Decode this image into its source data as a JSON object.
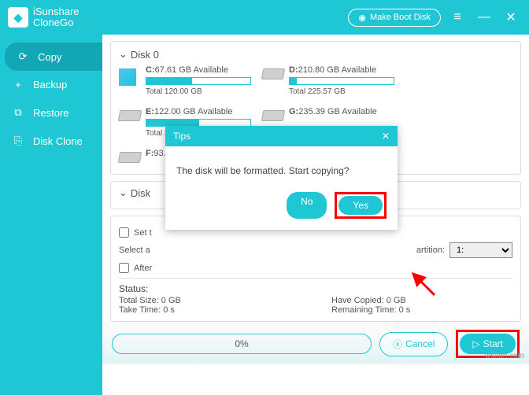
{
  "titlebar": {
    "brand1": "iSunshare",
    "brand2": "CloneGo",
    "bootDisk": "Make Boot Disk"
  },
  "sidebar": {
    "items": [
      {
        "label": "Copy",
        "icon": "⟳"
      },
      {
        "label": "Backup",
        "icon": "+"
      },
      {
        "label": "Restore",
        "icon": "⧉"
      },
      {
        "label": "Disk Clone",
        "icon": "⎘"
      }
    ]
  },
  "disk0": {
    "title": "Disk 0",
    "drives": [
      {
        "letter": "C:",
        "avail": "67.61 GB Available",
        "total": "Total 120.00 GB",
        "fill": 44,
        "icon": "win"
      },
      {
        "letter": "D:",
        "avail": "210.80 GB Available",
        "total": "Total 225.57 GB",
        "fill": 7,
        "icon": "hdd"
      },
      {
        "letter": "E:",
        "avail": "122.00 GB Available",
        "total": "Total 250.00 GB",
        "fill": 51,
        "icon": "hdd"
      },
      {
        "letter": "G:",
        "avail": "235.39 GB Available",
        "total": "",
        "fill": 0,
        "icon": "hdd"
      },
      {
        "letter": "F:",
        "avail": "93.12 GB Available",
        "total": "",
        "fill": 0,
        "icon": "hdd"
      }
    ]
  },
  "disk_other": {
    "title": "Disk"
  },
  "options": {
    "setLabel": "Set t",
    "selectLabel": "Select a",
    "afterLabel": "After",
    "partitionLabel": "artition:",
    "partitionValue": "1:"
  },
  "status": {
    "title": "Status:",
    "totalSize": "Total Size: 0 GB",
    "takeTime": "Take Time: 0 s",
    "haveCopied": "Have Copied: 0 GB",
    "remainTime": "Remaining Time: 0 s"
  },
  "footer": {
    "progress": "0%",
    "cancel": "Cancel",
    "start": "Start"
  },
  "dialog": {
    "title": "Tips",
    "message": "The disk will be formatted. Start copying?",
    "no": "No",
    "yes": "Yes"
  },
  "watermark": "wsxdn.com"
}
